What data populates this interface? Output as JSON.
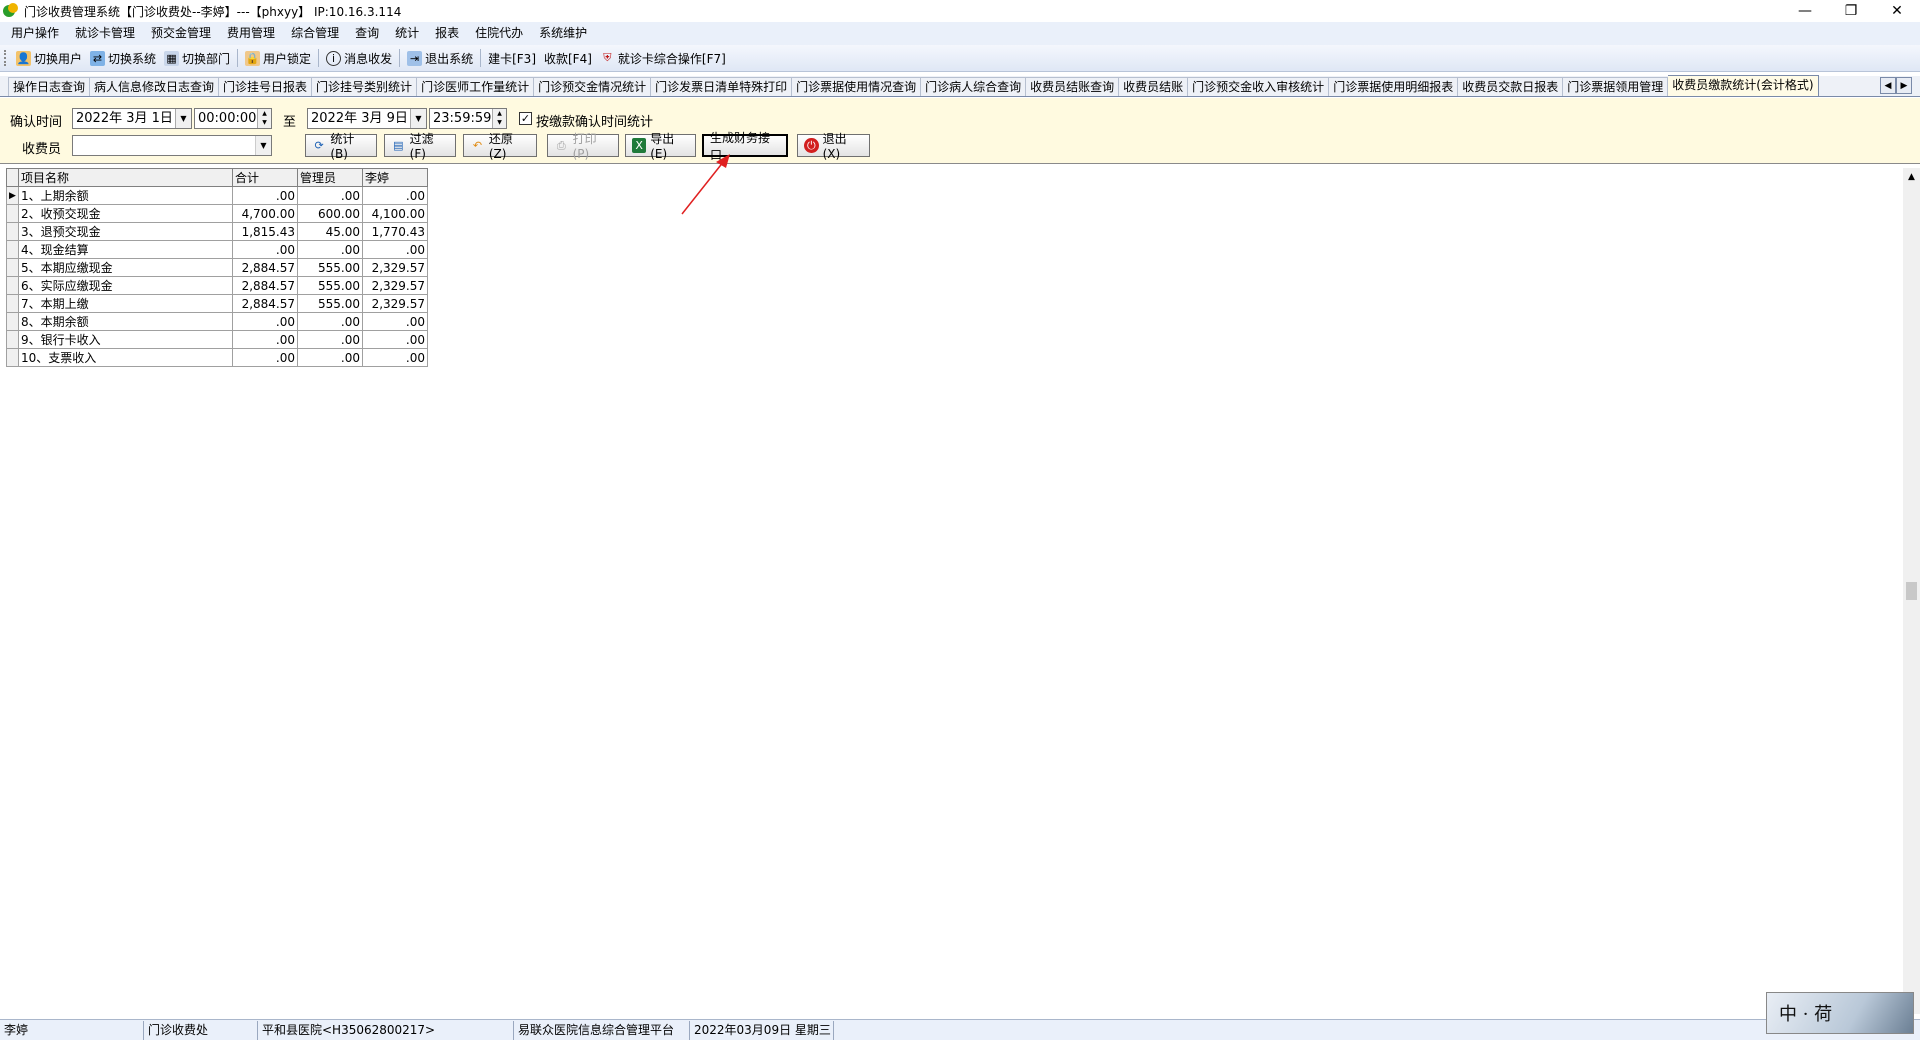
{
  "window": {
    "title": "门诊收费管理系统【门诊收费处--李婷】---【phxyy】 IP:10.16.3.114",
    "controls": [
      "—",
      "❐",
      "✕"
    ]
  },
  "menu": [
    "用户操作",
    "就诊卡管理",
    "预交金管理",
    "费用管理",
    "综合管理",
    "查询",
    "统计",
    "报表",
    "住院代办",
    "系统维护"
  ],
  "toolbar": [
    {
      "label": "切换用户",
      "icon": "user-switch-icon"
    },
    {
      "label": "切换系统",
      "icon": "system-switch-icon"
    },
    {
      "label": "切换部门",
      "icon": "department-switch-icon"
    },
    {
      "label": "用户锁定",
      "icon": "user-lock-icon"
    },
    {
      "label": "消息收发",
      "icon": "message-icon"
    },
    {
      "label": "退出系统",
      "icon": "exit-icon"
    },
    {
      "label": "建卡[F3]",
      "icon": ""
    },
    {
      "label": "收款[F4]",
      "icon": ""
    },
    {
      "label": "就诊卡综合操作[F7]",
      "icon": "card-icon"
    }
  ],
  "tabs": [
    "操作日志查询",
    "病人信息修改日志查询",
    "门诊挂号日报表",
    "门诊挂号类别统计",
    "门诊医师工作量统计",
    "门诊预交金情况统计",
    "门诊发票日清单特殊打印",
    "门诊票据使用情况查询",
    "门诊病人综合查询",
    "收费员结账查询",
    "收费员结账",
    "门诊预交金收入审核统计",
    "门诊票据使用明细报表",
    "收费员交款日报表",
    "门诊票据领用管理",
    "收费员缴款统计(会计格式)"
  ],
  "active_tab": 15,
  "filter": {
    "confirm_time_label": "确认时间",
    "start_date": "2022年 3月 1日",
    "start_time": "00:00:00",
    "to_label": "至",
    "end_date": "2022年 3月 9日",
    "end_time": "23:59:59",
    "checkbox_label": "按缴款确认时间统计",
    "checkbox_checked": true,
    "cashier_label": "收费员",
    "cashier_value": ""
  },
  "buttons": {
    "stat": "统计(B)",
    "filter": "过滤(F)",
    "restore": "还原(Z)",
    "print": "打印(P)",
    "export": "导出(E)",
    "finance": "生成财务接口",
    "exit": "退出(X)"
  },
  "grid": {
    "columns": [
      "项目名称",
      "合计",
      "管理员",
      "李婷"
    ],
    "rows": [
      [
        "1、上期余额",
        ".00",
        ".00",
        ".00"
      ],
      [
        "2、收预交现金",
        "4,700.00",
        "600.00",
        "4,100.00"
      ],
      [
        "3、退预交现金",
        "1,815.43",
        "45.00",
        "1,770.43"
      ],
      [
        "4、现金结算",
        ".00",
        ".00",
        ".00"
      ],
      [
        "5、本期应缴现金",
        "2,884.57",
        "555.00",
        "2,329.57"
      ],
      [
        "6、实际应缴现金",
        "2,884.57",
        "555.00",
        "2,329.57"
      ],
      [
        "7、本期上缴",
        "2,884.57",
        "555.00",
        "2,329.57"
      ],
      [
        "8、本期余额",
        ".00",
        ".00",
        ".00"
      ],
      [
        "9、银行卡收入",
        ".00",
        ".00",
        ".00"
      ],
      [
        "10、支票收入",
        ".00",
        ".00",
        ".00"
      ]
    ]
  },
  "status": [
    "李婷",
    "门诊收费处",
    "平和县医院<H35062800217>",
    "易联众医院信息综合管理平台",
    "2022年03月09日 星期三",
    ""
  ],
  "colors": {
    "accent": "#1a5fb4",
    "panel": "#fffae0",
    "annotation": "#e02020"
  }
}
